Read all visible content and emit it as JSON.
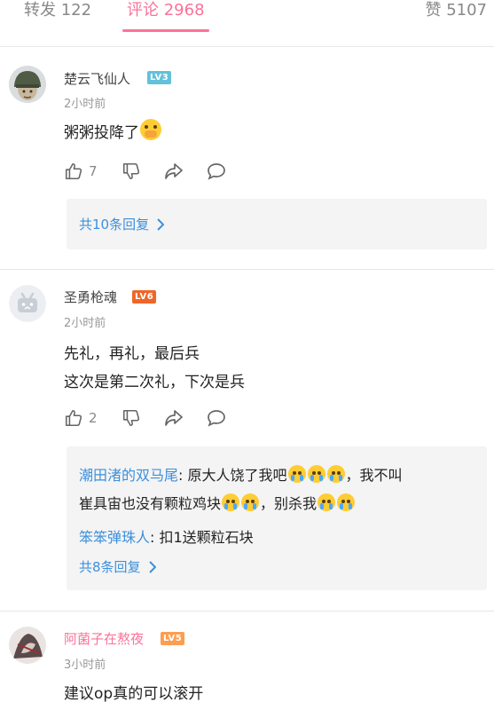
{
  "tabs": {
    "repost": "转发 122",
    "comments": "评论 2968",
    "likes": "赞 5107"
  },
  "comments": [
    {
      "user": "楚云飞仙人",
      "level": "LV3",
      "time": "2小时前",
      "lines": [
        "粥粥投降了"
      ],
      "emoji": "face-with-hand-over-mouth-emoji",
      "likes": "7",
      "replies_more": "共10条回复"
    },
    {
      "user": "圣勇枪魂",
      "level": "LV6",
      "time": "2小时前",
      "lines": [
        "先礼，再礼，最后兵",
        "这次是第二次礼，下次是兵"
      ],
      "likes": "2",
      "sub_replies": [
        {
          "user": "潮田渚的双马尾",
          "text_line1": ": 原大人饶了我吧",
          "text_line1_end": "，我不叫",
          "text_line2": "崔具宙也没有颗粒鸡块",
          "text_line2_end": "，别杀我",
          "emoji": "loudly-crying-emoji"
        },
        {
          "user": "笨笨弹珠人",
          "text": ": 扣1送颗粒石块"
        }
      ],
      "replies_more": "共8条回复"
    },
    {
      "user": "阿菌子在熬夜",
      "level": "LV5",
      "time": "3小时前",
      "lines": [
        "建议op真的可以滚开"
      ]
    }
  ]
}
